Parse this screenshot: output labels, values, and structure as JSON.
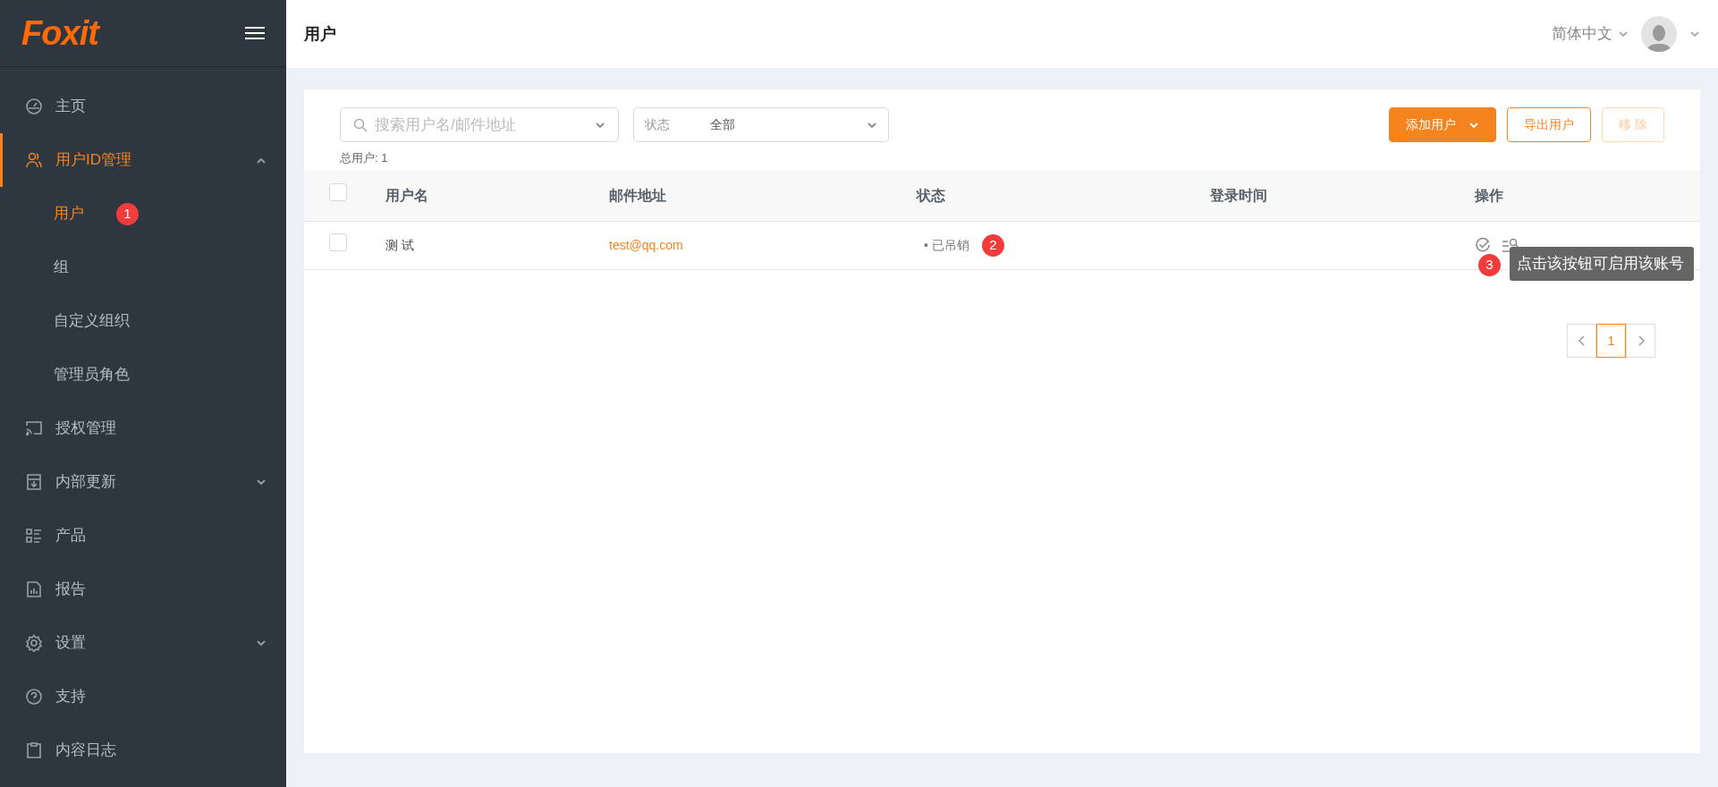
{
  "sidebar": {
    "logo": "Foxit",
    "items": [
      {
        "label": "主页",
        "selected": false
      },
      {
        "label": "用户ID管理",
        "selected": true,
        "expanded": true,
        "children": [
          {
            "label": "用户",
            "selected": true,
            "badge": "1"
          },
          {
            "label": "组",
            "selected": false
          },
          {
            "label": "自定义组织",
            "selected": false
          },
          {
            "label": "管理员角色",
            "selected": false
          }
        ]
      },
      {
        "label": "授权管理",
        "selected": false
      },
      {
        "label": "内部更新",
        "selected": false,
        "expanded": false
      },
      {
        "label": "产品",
        "selected": false
      },
      {
        "label": "报告",
        "selected": false
      },
      {
        "label": "设置",
        "selected": false,
        "expanded": false
      },
      {
        "label": "支持",
        "selected": false
      },
      {
        "label": "内容日志",
        "selected": false
      }
    ]
  },
  "header": {
    "title": "用户",
    "language": "简体中文"
  },
  "toolbar": {
    "search": {
      "placeholder": "搜索用户名/邮件地址"
    },
    "status_filter": {
      "label": "状态",
      "value": "全部"
    },
    "buttons": [
      {
        "label": "添加用户",
        "kind": "primary",
        "disabled": false
      },
      {
        "label": "导出用户",
        "kind": "outline",
        "disabled": false
      },
      {
        "label": "移 除",
        "kind": "outline",
        "disabled": true
      }
    ],
    "total": "总用户: 1"
  },
  "table": {
    "columns": [
      "用户名",
      "邮件地址",
      "状态",
      "登录时间",
      "操作"
    ],
    "rows": [
      {
        "checked": false,
        "username": "测 试",
        "email": "test@qq.com",
        "status": "• 已吊销",
        "status_badge": "2"
      }
    ],
    "header_checked": false
  },
  "tooltip": {
    "badge": "3",
    "text": "点击该按钮可启用该账号"
  },
  "pagination": {
    "pages": [
      {
        "label": "1",
        "selected": true
      }
    ]
  }
}
